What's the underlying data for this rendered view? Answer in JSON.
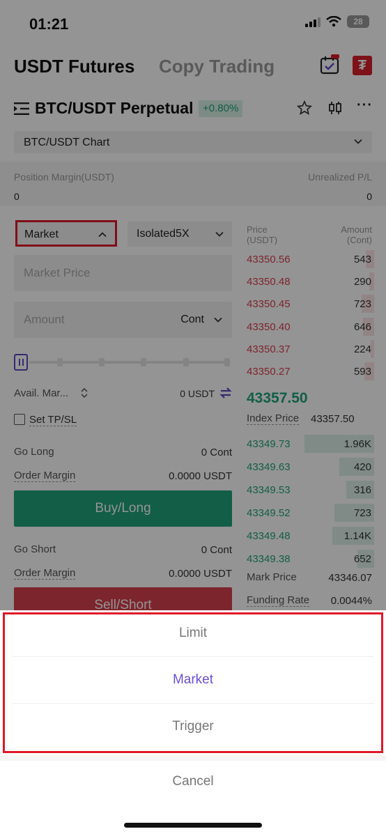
{
  "status_bar": {
    "time": "01:21",
    "battery": "28"
  },
  "header": {
    "tab_futures": "USDT Futures",
    "tab_copy": "Copy Trading",
    "icons": [
      "calendar-hot-icon",
      "tether-icon"
    ]
  },
  "pair": {
    "title": "BTC/USDT Perpetual",
    "change": "+0.80%"
  },
  "chart_selector": {
    "label": "BTC/USDT Chart"
  },
  "position": {
    "margin_label": "Position Margin(USDT)",
    "margin_value": "0",
    "upl_label": "Unrealized P/L",
    "upl_value": "0"
  },
  "order_form": {
    "order_type": "Market",
    "leverage": "Isolated5X",
    "price_placeholder": "Market Price",
    "amount_placeholder": "Amount",
    "amount_unit": "Cont",
    "slider_percent": 0,
    "avail_label": "Avail. Mar...",
    "avail_value": "0 USDT",
    "tpsl_label": "Set TP/SL",
    "go_long_label": "Go Long",
    "go_long_value": "0 Cont",
    "order_margin_label": "Order Margin",
    "order_margin_long": "0.0000 USDT",
    "buy_label": "Buy/Long",
    "go_short_label": "Go Short",
    "go_short_value": "0 Cont",
    "order_margin_short": "0.0000 USDT",
    "sell_label": "Sell/Short"
  },
  "orderbook": {
    "price_header_1": "Price",
    "price_header_2": "(USDT)",
    "amount_header_1": "Amount",
    "amount_header_2": "(Cont)",
    "asks": [
      {
        "price": "43350.56",
        "amount": "543",
        "depth": 0.2
      },
      {
        "price": "43350.48",
        "amount": "290",
        "depth": 0.12
      },
      {
        "price": "43350.45",
        "amount": "723",
        "depth": 0.3
      },
      {
        "price": "43350.40",
        "amount": "646",
        "depth": 0.26
      },
      {
        "price": "43350.37",
        "amount": "224",
        "depth": 0.09
      },
      {
        "price": "43350.27",
        "amount": "593",
        "depth": 0.23
      }
    ],
    "last_price": "43357.50",
    "index_label": "Index Price",
    "index_value": "43357.50",
    "bids": [
      {
        "price": "43349.73",
        "amount": "1.96K",
        "depth": 1.0
      },
      {
        "price": "43349.63",
        "amount": "420",
        "depth": 0.5
      },
      {
        "price": "43349.53",
        "amount": "316",
        "depth": 0.4
      },
      {
        "price": "43349.52",
        "amount": "723",
        "depth": 0.57
      },
      {
        "price": "43349.48",
        "amount": "1.14K",
        "depth": 0.6
      },
      {
        "price": "43349.38",
        "amount": "652",
        "depth": 0.24
      }
    ],
    "mark_label": "Mark Price",
    "mark_value": "43346.07",
    "funding_label": "Funding Rate",
    "funding_value": "0.0044%"
  },
  "sheet": {
    "options": [
      "Limit",
      "Market",
      "Trigger"
    ],
    "selected": "Market",
    "cancel": "Cancel"
  }
}
